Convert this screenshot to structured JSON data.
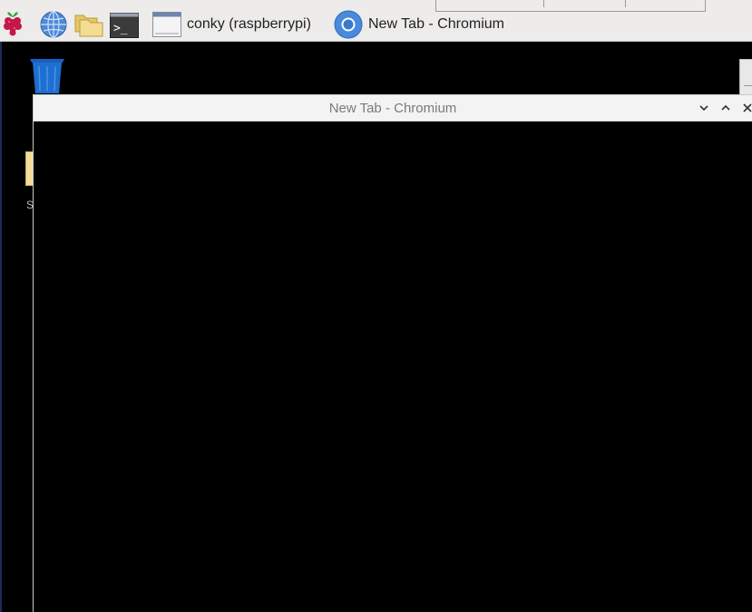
{
  "taskbar": {
    "launchers": [
      {
        "name": "raspberry-menu",
        "icon": "raspberry-icon"
      },
      {
        "name": "web-browser",
        "icon": "globe-icon"
      },
      {
        "name": "file-manager",
        "icon": "folder-icon"
      },
      {
        "name": "terminal",
        "icon": "terminal-icon"
      }
    ],
    "tasks": [
      {
        "label": "conky (raspberrypi)",
        "icon": "window-icon"
      },
      {
        "label": "New Tab - Chromium",
        "icon": "chromium-icon"
      }
    ]
  },
  "desktop": {
    "trash": {
      "icon": "trash-icon"
    },
    "folder_label_peek": "S"
  },
  "window": {
    "title": "New Tab - Chromium",
    "controls": [
      "minimize",
      "maximize",
      "close"
    ]
  },
  "colors": {
    "taskbar_bg": "#edeceb",
    "desktop_bg": "#000000",
    "titlebar_bg": "#f3f3f3",
    "trash_blue": "#1e6fd1",
    "chromium_blue": "#3a7bd5"
  }
}
